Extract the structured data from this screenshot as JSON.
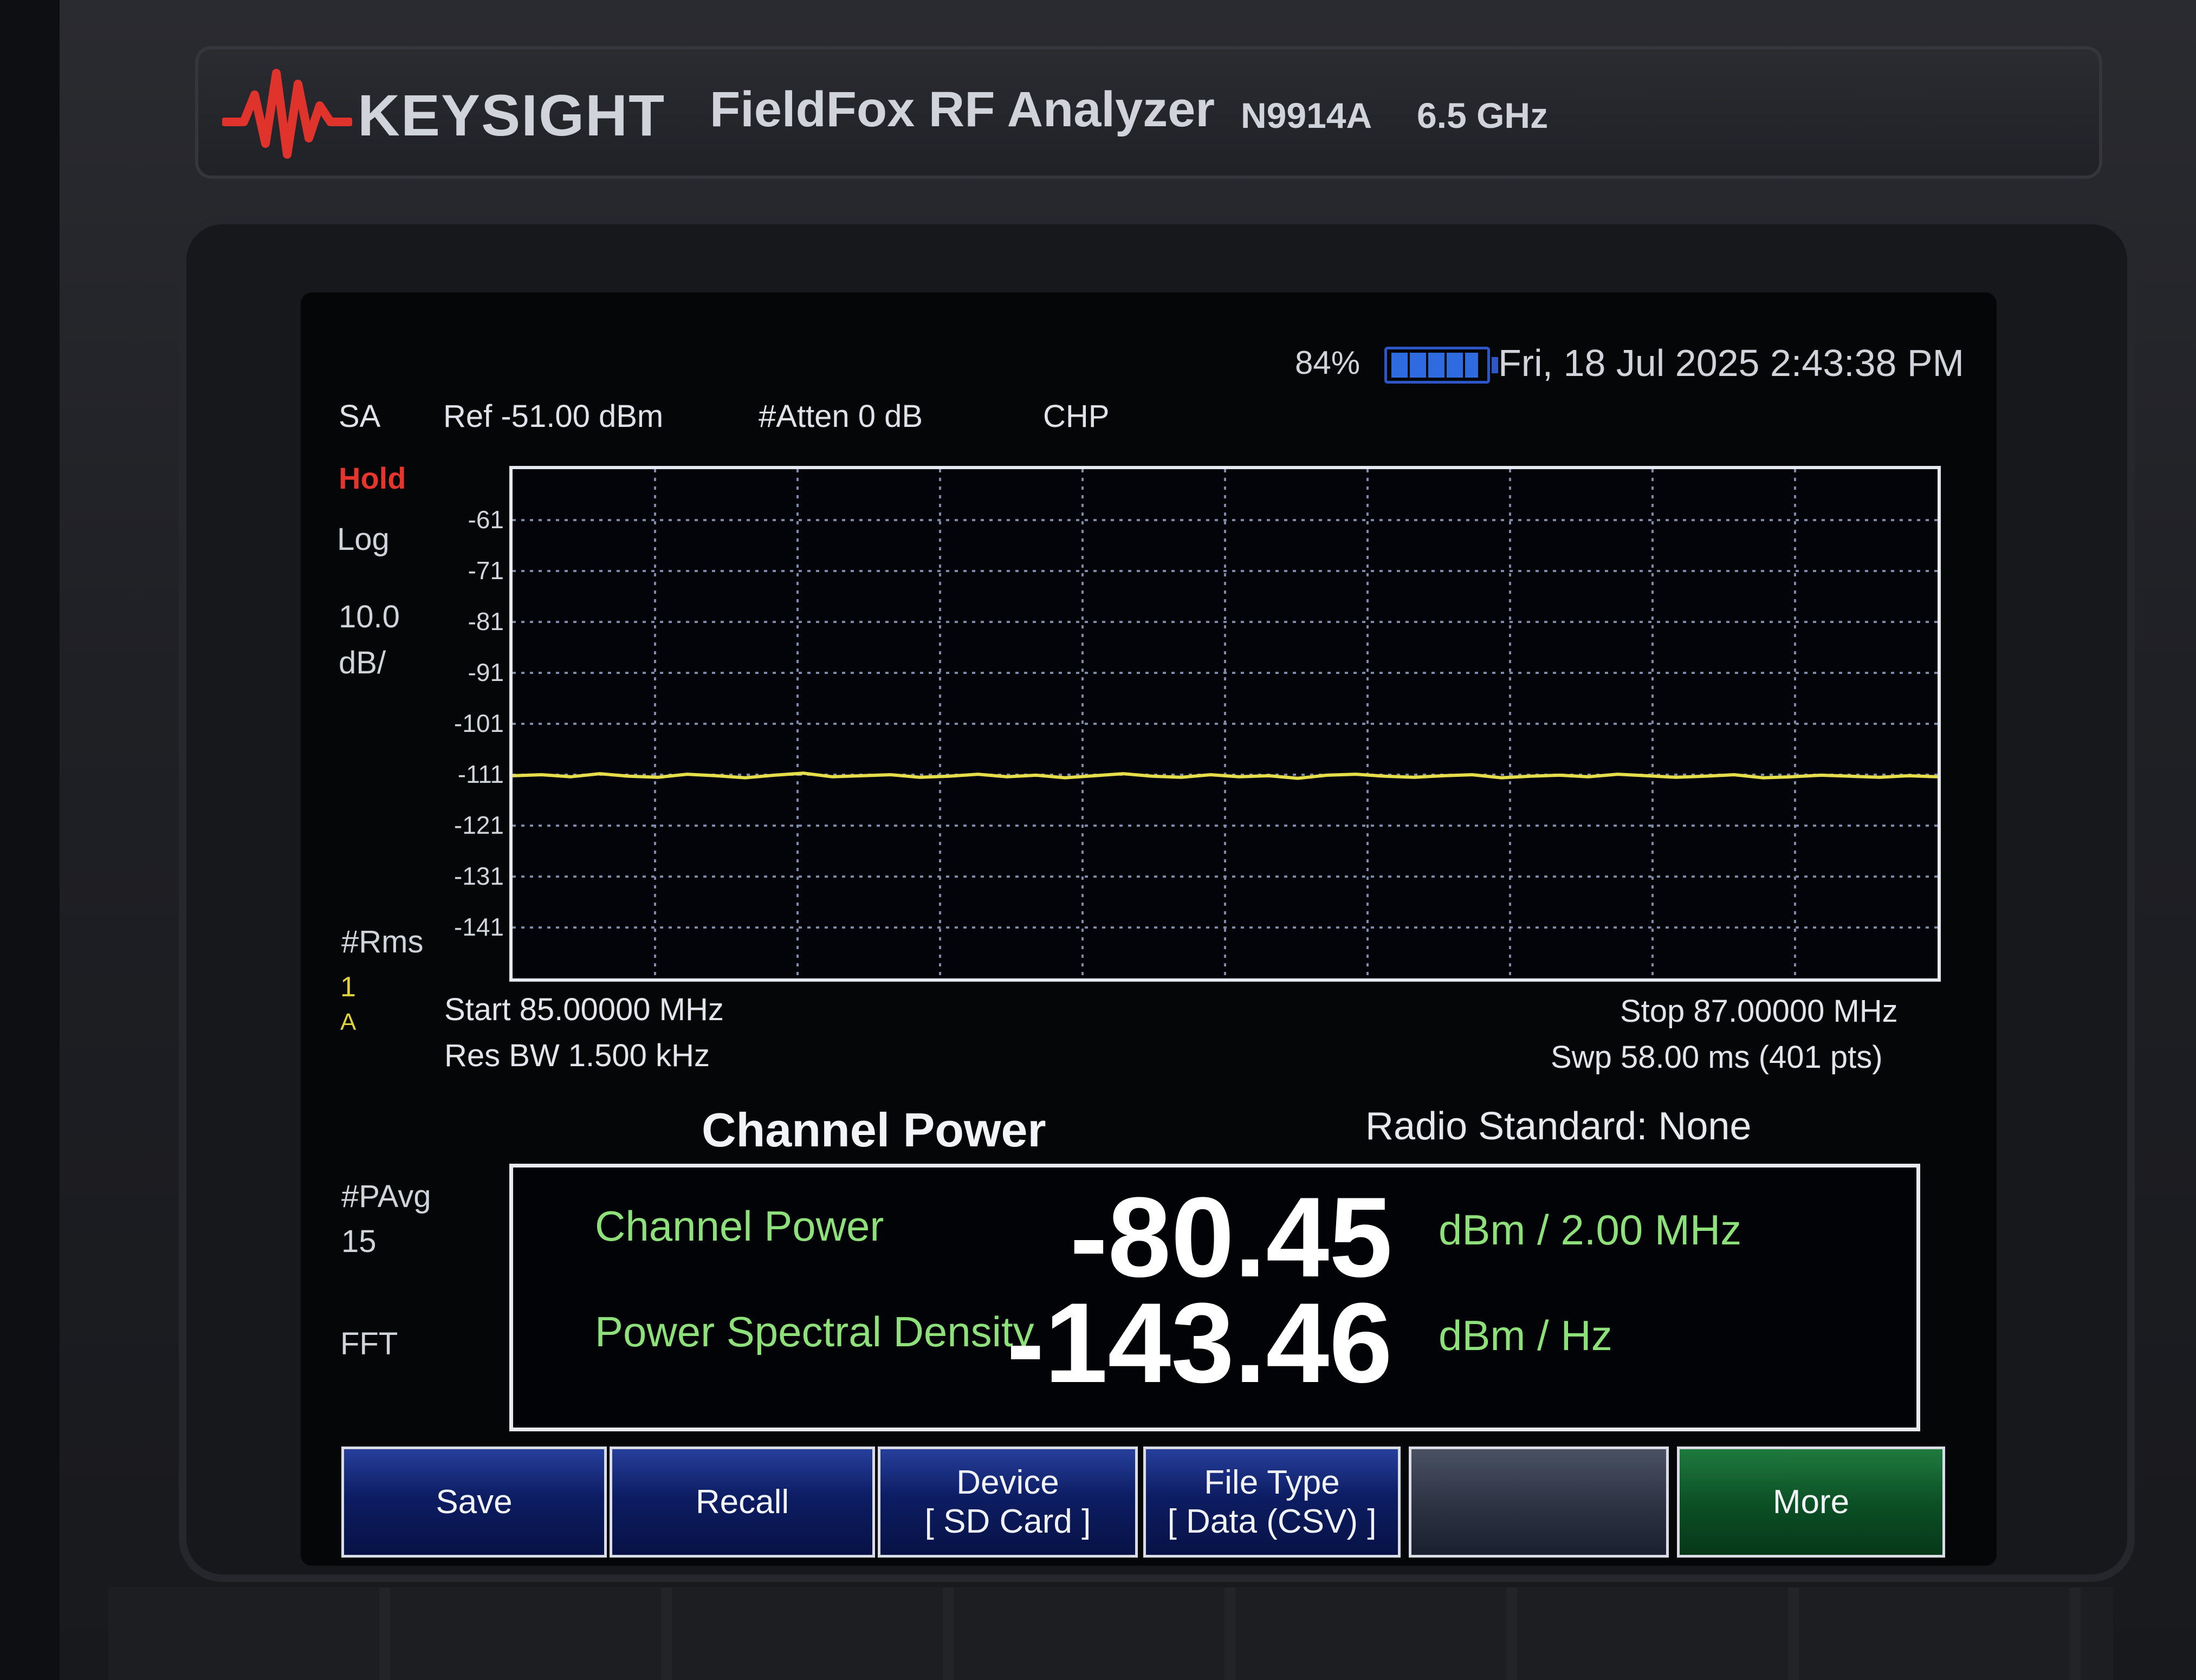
{
  "device": {
    "brand": "KEYSIGHT",
    "product": "FieldFox RF Analyzer",
    "model": "N9914A",
    "frequency_range": "6.5 GHz"
  },
  "status": {
    "battery_percent": "84%",
    "battery_level": 0.84,
    "datetime": "Fri, 18 Jul 2025 2:43:38 PM"
  },
  "header": {
    "mode": "SA",
    "ref": "Ref -51.00 dBm",
    "atten": "#Atten 0 dB",
    "measurement": "CHP"
  },
  "left_panel": {
    "hold": "Hold",
    "scale": "Log",
    "scale_per_div_value": "10.0",
    "scale_per_div_unit": "dB/",
    "detector": "#Rms",
    "trace_num": "1",
    "trace_state": "A",
    "pavg_label": "#PAvg",
    "pavg_value": "15",
    "sweep_mode": "FFT"
  },
  "chart_data": {
    "type": "line",
    "ylabel_ticks": [
      "-61",
      "-71",
      "-81",
      "-91",
      "-101",
      "-111",
      "-121",
      "-131",
      "-141"
    ],
    "ylim": [
      -151,
      -51
    ],
    "xlim_mhz": [
      85.0,
      87.0
    ],
    "grid": true,
    "series": [
      {
        "color": "#e5de4a",
        "y": [
          -111.2,
          -111.0,
          -111.4,
          -110.8,
          -111.3,
          -111.5,
          -110.9,
          -111.2,
          -111.6,
          -111.1,
          -110.7,
          -111.4,
          -111.2,
          -111.0,
          -111.5,
          -111.3,
          -110.9,
          -111.4,
          -111.1,
          -111.6,
          -111.2,
          -110.8,
          -111.3,
          -111.5,
          -111.0,
          -111.4,
          -111.2,
          -111.7,
          -111.1,
          -110.9,
          -111.3,
          -111.5,
          -111.2,
          -111.0,
          -111.6,
          -111.3,
          -111.1,
          -111.4,
          -110.9,
          -111.2,
          -111.5,
          -111.3,
          -111.0,
          -111.6,
          -111.4,
          -111.1,
          -111.3,
          -111.5,
          -111.2,
          -111.4
        ]
      }
    ]
  },
  "freq_info": {
    "start": "Start 85.00000 MHz",
    "stop": "Stop 87.00000 MHz",
    "res_bw": "Res BW 1.500 kHz",
    "sweep": "Swp 58.00 ms (401 pts)"
  },
  "results": {
    "title": "Channel Power",
    "radio_standard": "Radio Standard: None",
    "channel_power_label": "Channel Power",
    "channel_power_value": "-80.45",
    "channel_power_unit": "dBm / 2.00 MHz",
    "psd_label": "Power Spectral Density",
    "psd_value": "-143.46",
    "psd_unit": "dBm / Hz"
  },
  "softkeys": [
    {
      "line1": "Save",
      "line2": ""
    },
    {
      "line1": "Recall",
      "line2": ""
    },
    {
      "line1": "Device",
      "line2": "[ SD Card ]"
    },
    {
      "line1": "File Type",
      "line2": "[ Data (CSV) ]"
    },
    {
      "line1": "",
      "line2": ""
    },
    {
      "line1": "More",
      "line2": ""
    }
  ]
}
